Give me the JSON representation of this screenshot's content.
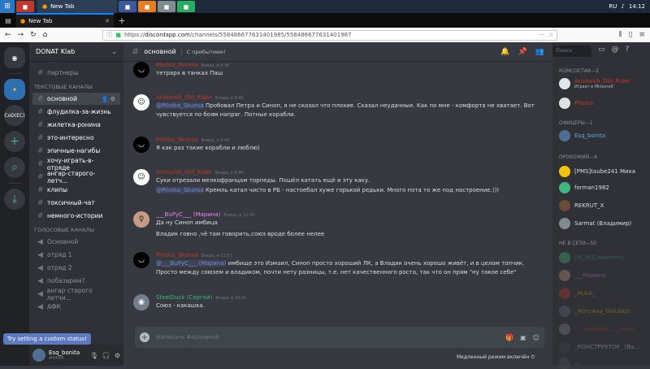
{
  "taskbar": {
    "lang": "RU",
    "time": "14:12"
  },
  "browser": {
    "tab_title": "New Tab",
    "new_tab": "+",
    "url_prefix": "https://",
    "url_domain": "discordapp.com",
    "url_path": "/channels/558486677631401985/558486677631401987"
  },
  "servers": [
    {
      "name": "home",
      "label": ""
    },
    {
      "name": "donat",
      "label": ""
    },
    {
      "name": "codec",
      "label": "CoD(EC)"
    },
    {
      "name": "add",
      "label": "+"
    },
    {
      "name": "explore",
      "label": ""
    },
    {
      "name": "download",
      "label": ""
    }
  ],
  "guild": {
    "name": "DONAT Klab",
    "chevron": "⌄"
  },
  "channels_top": [
    {
      "label": "партнеры"
    }
  ],
  "category_text": "ТЕКСТОВЫЕ КАНАЛЫ",
  "text_channels": [
    {
      "label": "основной",
      "active": true
    },
    {
      "label": "флудилка-за-жизнь"
    },
    {
      "label": "жилетка-ронина"
    },
    {
      "label": "это-интересно"
    },
    {
      "label": "эпичные-нагибы"
    },
    {
      "label": "хочу-играть-в-отряде"
    },
    {
      "label": "ангар-старого-летч..."
    },
    {
      "label": "клипы"
    },
    {
      "label": "токсичный-чат"
    },
    {
      "label": "немного-истории"
    }
  ],
  "category_voice": "ГОЛОСОВЫЕ КАНАЛЫ",
  "voice_channels": [
    {
      "label": "Основной"
    },
    {
      "label": "отряд 1"
    },
    {
      "label": "отряд 2"
    },
    {
      "label": "побазарим?"
    },
    {
      "label": "ангар старого летчи..."
    },
    {
      "label": "АФК"
    }
  ],
  "user": {
    "name": "Esq_bonita",
    "tag": "#6688"
  },
  "tooltip": "Try setting a custom status!",
  "chat_header": {
    "channel": "основной",
    "topic": "С прибытием!",
    "search": "Поиск"
  },
  "messages": [
    {
      "author": "Pilotka_Skunsa",
      "author_color": "#c0392b",
      "time": "Вчера, в 8:36",
      "text": "тетрарх в танках Паш",
      "avatar": "dark"
    },
    {
      "author": "Aristarkh_Old_Rider",
      "author_color": "#c0392b",
      "time": "Вчера, в 8:40",
      "mention": "@Pilotka_Skunsa",
      "text": " Пробовал Петра и Синоп, я не сказал что плохие. Сказал неудачные. Как по мне - комфорта не хватает. Вот чувствуется по боям напряг.  Потные корабли.",
      "avatar": "face"
    },
    {
      "author": "Pilotka_Skunsa",
      "author_color": "#c0392b",
      "time": "Вчера, в 8:40",
      "text": "Я как раз такие корабли и люблю)",
      "avatar": "dark"
    },
    {
      "author": "Aristarkh_Old_Rider",
      "author_color": "#c0392b",
      "time": "Вчера, в 8:40",
      "text": "Суки отрезали мелкофранцам торпеды. Пошёл катать ещё и эту каку.",
      "mention": "@Pilotka_Skunsa",
      "text2": " Кремль катал чисто в РБ - настоебал хуже горькой редьки. Много пота то же под настроение.)))",
      "avatar": "face"
    },
    {
      "author": "___BuPyC___ (Марина)",
      "author_color": "#f47fff",
      "time": "Вчера, в 12:26",
      "text": "Да ну Синоп имбица",
      "text2": "Владик говно ,чё там говорить,союз вроде более нелее",
      "avatar": "girl"
    },
    {
      "author": "Pilotka_Skunsa",
      "author_color": "#c0392b",
      "time": "Вчера, в 12:57",
      "mention": "@___BuPyC___ (Марина)",
      "text": " имбище это Измаил, Синоп просто хороший ЛК, а Владик очень хорошо живёт, и в целом топчик. Просто между союзем и владиком, почти нету разницы, т.е. нет качественного роста, так что он прям \"ну такое себе\"",
      "avatar": "dark"
    },
    {
      "author": "SteelDuck (Сергей)",
      "author_color": "#43b581",
      "time": "Вчера, в 16:20",
      "text": "Союз - какашка.",
      "avatar": "disc"
    }
  ],
  "compose": {
    "placeholder": "Написать #основной",
    "slowmode": "Медленный режим включён"
  },
  "member_groups": [
    {
      "title": "КОМСОСТАВ—2",
      "members": [
        {
          "name": "Aristarkh_Old_Rider",
          "color": "#c0392b",
          "sub": "Играет в Minecraft",
          "avatar": "#dfe6ec"
        },
        {
          "name": "Pilotka",
          "color": "#c0392b",
          "avatar": "#e0e0e0"
        }
      ]
    },
    {
      "title": "ОФИЦЕРЫ—1",
      "members": [
        {
          "name": "Esq_bonita",
          "color": "#5dade2",
          "avatar": "#4e6f8f"
        }
      ]
    },
    {
      "title": "ПРОХОЖИЙ—4",
      "members": [
        {
          "name": "[PMS]taube241 Миха",
          "color": "#dcddde",
          "avatar": "#f1c40f"
        },
        {
          "name": "forman1982",
          "color": "#dcddde",
          "avatar": "#43b581"
        },
        {
          "name": "REKRUT_X",
          "color": "#dcddde",
          "avatar": "#6b4c3b"
        },
        {
          "name": "Sarmat (Владимир)",
          "color": "#dcddde",
          "avatar": "#7f8c8d"
        }
      ]
    },
    {
      "title": "НЕ В СЕТИ—50",
      "members": [
        {
          "name": "[W_W]Cadamony...",
          "color": "#43b581",
          "avatar": "#43b581",
          "offline": true
        },
        {
          "name": "___Марина",
          "color": "#f47fff",
          "avatar": "#c89b86",
          "offline": true
        },
        {
          "name": "_HukA_",
          "color": "#f1c40f",
          "avatar": "#c0392b",
          "offline": true
        },
        {
          "name": "_Hony4ay_Golubkin",
          "color": "#f1c40f",
          "avatar": "#5d6d7e",
          "offline": true
        },
        {
          "name": "__ComarokL...__Kona",
          "color": "#c0392b",
          "avatar": "#7f8c8d",
          "offline": true
        },
        {
          "name": "_КОНСТРУКТОР_ (Ва...",
          "color": "#dcddde",
          "avatar": "#444",
          "offline": true
        },
        {
          "name": "...",
          "color": "#dcddde",
          "avatar": "#555",
          "offline": true
        }
      ]
    }
  ]
}
